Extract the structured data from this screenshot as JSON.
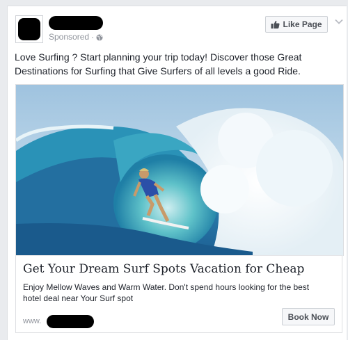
{
  "post": {
    "page_name": "",
    "sponsored_label": "Sponsored",
    "separator": "·",
    "like_page_label": "Like Page",
    "body_text": "Love Surfing ? Start planning your trip today! Discover those Great Destinations for Surfing that Give Surfers of all levels a good Ride."
  },
  "card": {
    "image_alt": "Surfer riding inside a barrel wave",
    "title": "Get Your Dream Surf Spots Vacation for Cheap",
    "description": "Enjoy Mellow Waves and Warm Water. Don't spend hours looking for the best hotel deal near Your Surf spot",
    "url_prefix": "www.",
    "cta_label": "Book Now"
  },
  "icons": {
    "globe": "globe-icon",
    "thumb": "thumbs-up-icon",
    "menu": "chevron-down-icon"
  },
  "colors": {
    "page_bg": "#e9ebee",
    "secondary_text": "#90949c",
    "button_text": "#4b4f56"
  }
}
